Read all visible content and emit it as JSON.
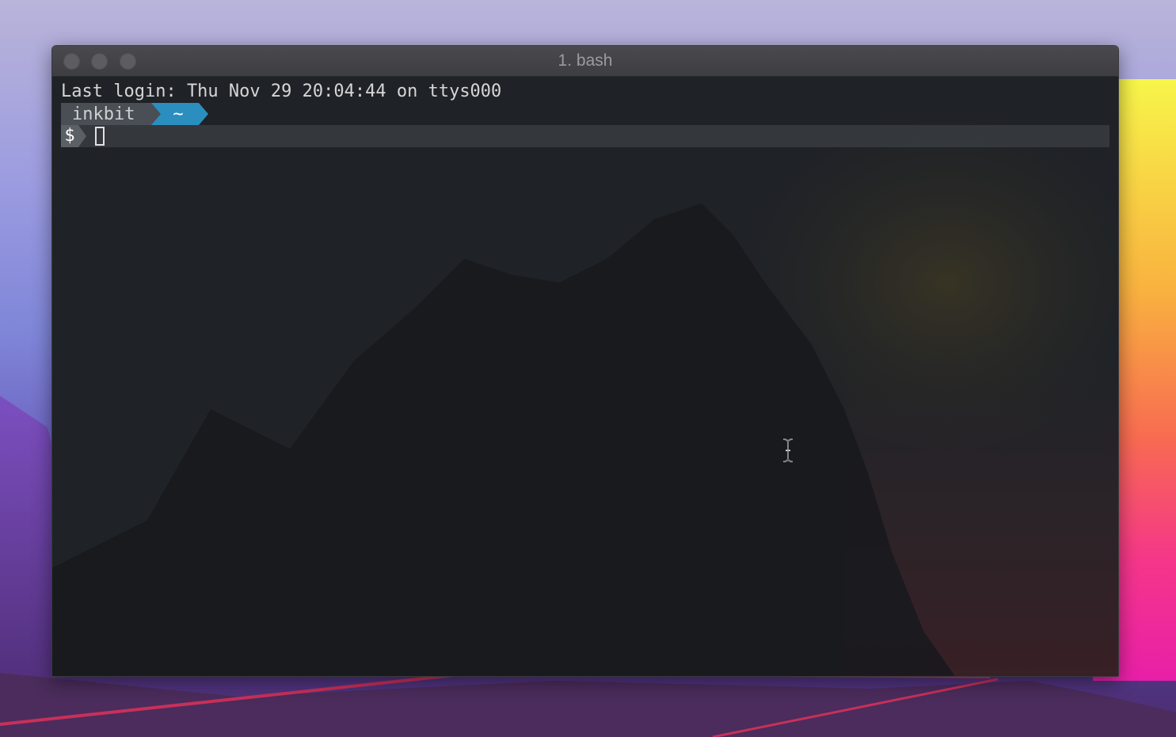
{
  "window": {
    "title": "1. bash"
  },
  "terminal": {
    "login_line": "Last login: Thu Nov 29 20:04:44 on ttys000",
    "prompt_user": "inkbit",
    "prompt_dir": "~",
    "prompt_symbol": "$",
    "input_value": ""
  },
  "colors": {
    "prompt_user_bg": "#4a4e55",
    "prompt_dir_bg": "#2a8fbf",
    "terminal_bg": "#1e2126",
    "titlebar_text": "#9c9ca0"
  },
  "icons": {
    "close": "traffic-light-close-icon",
    "minimize": "traffic-light-minimize-icon",
    "zoom": "traffic-light-zoom-icon",
    "cursor": "text-ibeam-cursor-icon"
  }
}
